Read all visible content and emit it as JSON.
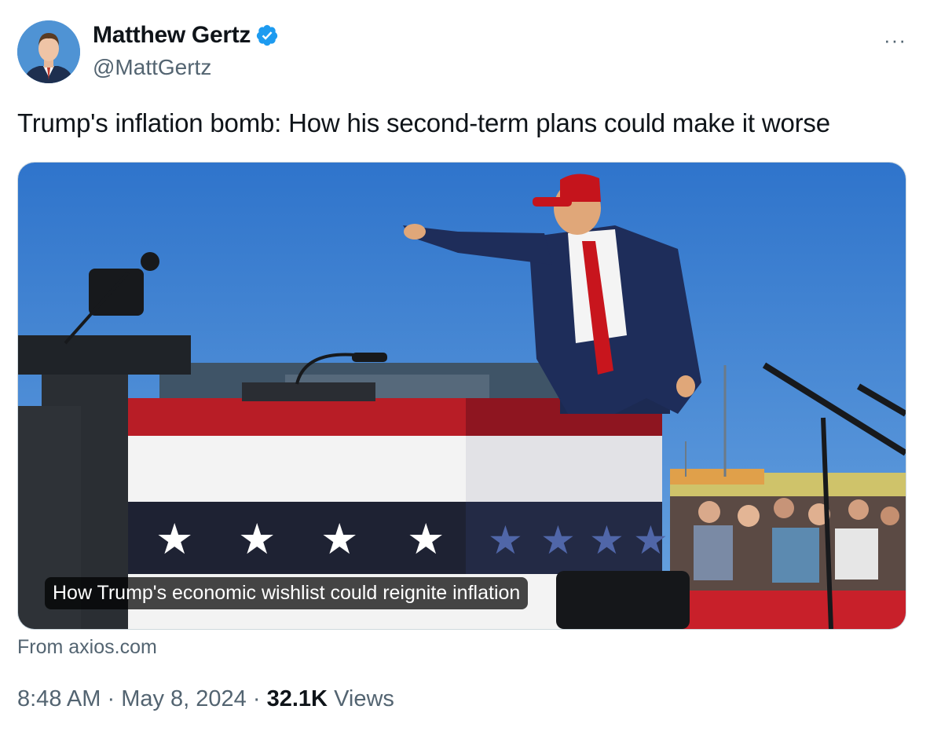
{
  "tweet": {
    "author": {
      "display_name": "Matthew Gertz",
      "handle": "@MattGertz",
      "verified": true
    },
    "more_label": "···",
    "text": "Trump's inflation bomb: How his second-term plans could make it worse",
    "card": {
      "caption": "How Trump's economic wishlist could reignite inflation",
      "source": "From axios.com"
    },
    "meta": {
      "time": "8:48 AM",
      "separator": "·",
      "date": "May 8, 2024",
      "views_count": "32.1K",
      "views_label": "Views"
    }
  },
  "colors": {
    "accent": "#1d9bf0",
    "secondary_text": "#536471",
    "sky": "#3a7ed0"
  }
}
